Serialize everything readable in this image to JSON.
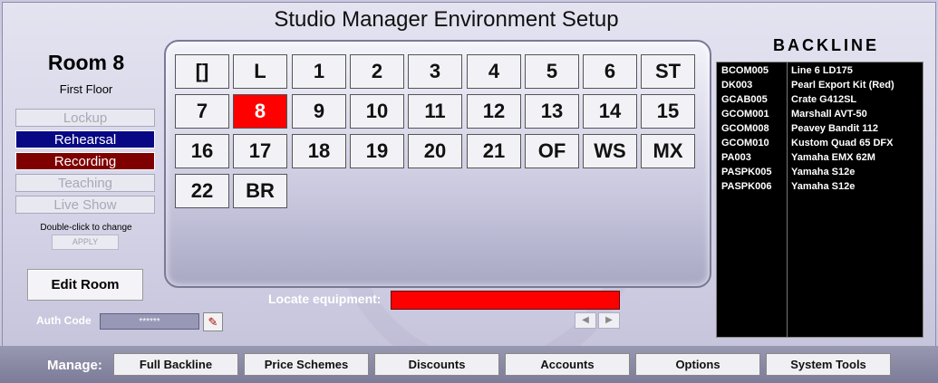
{
  "window": {
    "title": "Studio Manager Environment Setup"
  },
  "room": {
    "name": "Room 8",
    "floor": "First Floor"
  },
  "modes": [
    {
      "label": "Lockup",
      "state": "off"
    },
    {
      "label": "Rehearsal",
      "state": "rehearsal"
    },
    {
      "label": "Recording",
      "state": "recording"
    },
    {
      "label": "Teaching",
      "state": "off"
    },
    {
      "label": "Live Show",
      "state": "off"
    }
  ],
  "mode_hint": "Double-click to change",
  "apply_label": "APPLY",
  "edit_room_label": "Edit Room",
  "auth": {
    "label": "Auth Code",
    "value": "******"
  },
  "rooms": {
    "rows": [
      [
        "[]",
        "L",
        "1",
        "2",
        "3",
        "4",
        "5",
        "6",
        "ST"
      ],
      [
        "7",
        "8",
        "9",
        "10",
        "11",
        "12",
        "13",
        "14",
        "15"
      ],
      [
        "16",
        "17",
        "18",
        "19",
        "20",
        "21",
        "OF",
        "WS",
        "MX"
      ],
      [
        "22",
        "BR"
      ]
    ],
    "active": "8",
    "active_color": "#ff0000"
  },
  "locate": {
    "label": "Locate equipment:",
    "value": ""
  },
  "backline": {
    "title": "BACKLINE",
    "items": [
      {
        "code": "BCOM005",
        "name": "Line 6 LD175"
      },
      {
        "code": "DK003",
        "name": "Pearl Export Kit (Red)"
      },
      {
        "code": "GCAB005",
        "name": "Crate G412SL"
      },
      {
        "code": "GCOM001",
        "name": "Marshall AVT-50"
      },
      {
        "code": "GCOM008",
        "name": "Peavey Bandit 112"
      },
      {
        "code": "GCOM010",
        "name": "Kustom Quad 65 DFX"
      },
      {
        "code": "PA003",
        "name": "Yamaha EMX 62M"
      },
      {
        "code": "PASPK005",
        "name": "Yamaha S12e"
      },
      {
        "code": "PASPK006",
        "name": "Yamaha S12e"
      }
    ]
  },
  "footer": {
    "manage_label": "Manage:",
    "buttons": [
      "Full Backline",
      "Price Schemes",
      "Discounts",
      "Accounts",
      "Options",
      "System Tools"
    ]
  },
  "colors": {
    "rehearsal": "#080884",
    "recording": "#7f0000",
    "locate": "#ff0000"
  }
}
